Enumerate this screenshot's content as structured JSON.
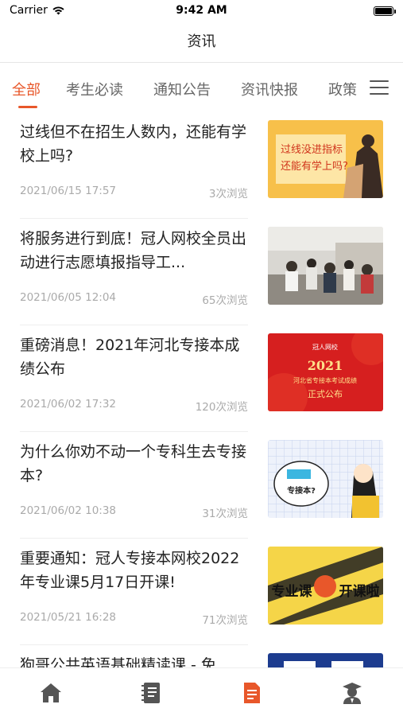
{
  "status_bar": {
    "carrier": "Carrier",
    "time": "9:42 AM"
  },
  "nav": {
    "title": "资讯"
  },
  "tabs": [
    {
      "label": "全部",
      "active": true
    },
    {
      "label": "考生必读",
      "active": false
    },
    {
      "label": "通知公告",
      "active": false
    },
    {
      "label": "资讯快报",
      "active": false
    },
    {
      "label": "政策",
      "active": false
    }
  ],
  "tab_menu_icon": "hamburger-menu-icon",
  "articles": [
    {
      "title": "过线但不在招生人数内，还能有学校上吗?",
      "date": "2021/06/15 17:57",
      "views": "3次浏览",
      "thumb_text": [
        "过线没进指标",
        "还能有学上吗?"
      ]
    },
    {
      "title": "将服务进行到底！冠人网校全员出动进行志愿填报指导工...",
      "date": "2021/06/05 12:04",
      "views": "65次浏览"
    },
    {
      "title": "重磅消息！2021年河北专接本成绩公布",
      "date": "2021/06/02 17:32",
      "views": "120次浏览",
      "thumb_text": [
        "冠人网校",
        "2021",
        "河北省专接本考试成绩",
        "正式公布"
      ]
    },
    {
      "title": "为什么你劝不动一个专科生去专接本?",
      "date": "2021/06/02 10:38",
      "views": "31次浏览",
      "thumb_text": [
        "专接本?"
      ]
    },
    {
      "title": "重要通知：冠人专接本网校2022年专业课5月17日开课!",
      "date": "2021/05/21 16:28",
      "views": "71次浏览",
      "thumb_text": [
        "专业课",
        "开课啦"
      ]
    },
    {
      "title": "狗哥公共英语基础精读课 - 免",
      "date": "",
      "views": ""
    }
  ],
  "tabbar": [
    {
      "name": "home-icon",
      "active": false,
      "color": "#555555"
    },
    {
      "name": "course-book-icon",
      "active": false,
      "color": "#555555"
    },
    {
      "name": "news-document-icon",
      "active": true,
      "color": "#e8572a"
    },
    {
      "name": "profile-graduate-icon",
      "active": false,
      "color": "#555555"
    }
  ],
  "colors": {
    "accent": "#e8572a",
    "text": "#222222",
    "meta": "#aaaaaa"
  }
}
